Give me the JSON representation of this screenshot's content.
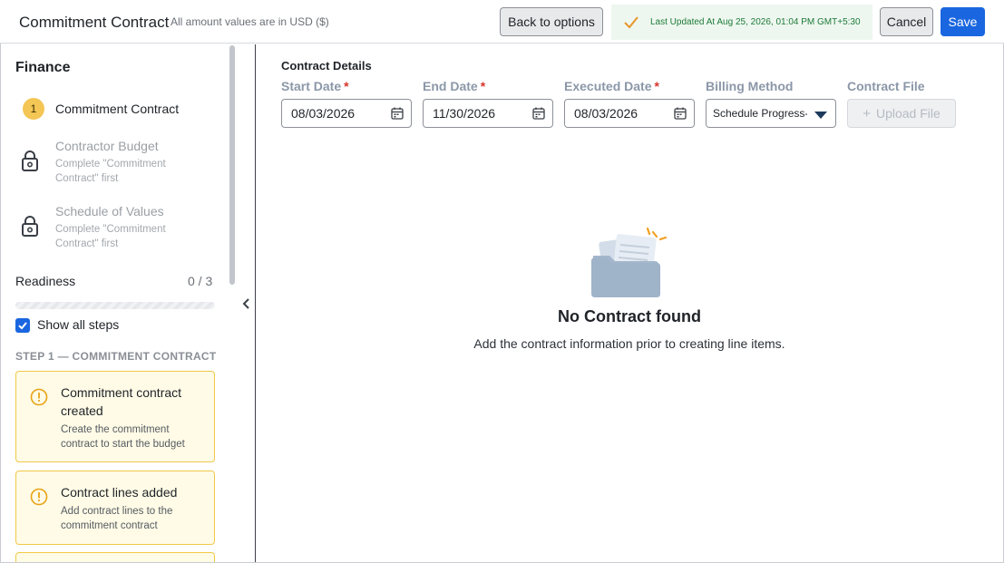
{
  "header": {
    "title": "Commitment Contract",
    "subtitle": "All amount values are in USD ($)",
    "back_label": "Back to options",
    "status_text": "Last Updated At Aug 25, 2026, 01:04 PM GMT+5:30",
    "cancel_label": "Cancel",
    "save_label": "Save"
  },
  "sidebar": {
    "heading": "Finance",
    "steps": [
      {
        "number": "1",
        "label": "Commitment Contract"
      },
      {
        "label": "Contractor Budget",
        "sub": "Complete \"Commitment Contract\" first"
      },
      {
        "label": "Schedule of Values",
        "sub": "Complete \"Commitment Contract\" first"
      }
    ],
    "readiness_label": "Readiness",
    "readiness_count": "0 / 3",
    "readiness_progress": 0,
    "show_all_label": "Show all steps",
    "show_all_checked": true,
    "step_caption": "STEP 1 — COMMITMENT CONTRACT",
    "cards": [
      {
        "title": "Commitment contract created",
        "sub": "Create the commitment contract to start the budget"
      },
      {
        "title": "Contract lines added",
        "sub": "Add contract lines to the commitment contract"
      }
    ]
  },
  "main": {
    "section_title": "Contract Details",
    "fields": {
      "start_date": {
        "label": "Start Date",
        "required": "*",
        "value": "08/03/2026"
      },
      "end_date": {
        "label": "End Date",
        "required": "*",
        "value": "11/30/2026"
      },
      "executed_date": {
        "label": "Executed Date",
        "required": "*",
        "value": "08/03/2026"
      },
      "billing_method": {
        "label": "Billing Method",
        "value": "Schedule Progress-"
      },
      "contract_file": {
        "label": "Contract File",
        "button": "Upload File"
      }
    },
    "empty_title": "No Contract found",
    "empty_sub": "Add the contract information prior to creating line items."
  },
  "colors": {
    "primary": "#1a66e0",
    "warning_border": "#f1c84a",
    "warning_bg": "#fffbe6",
    "success_bg": "#eef7ef",
    "required": "#d9342b"
  }
}
